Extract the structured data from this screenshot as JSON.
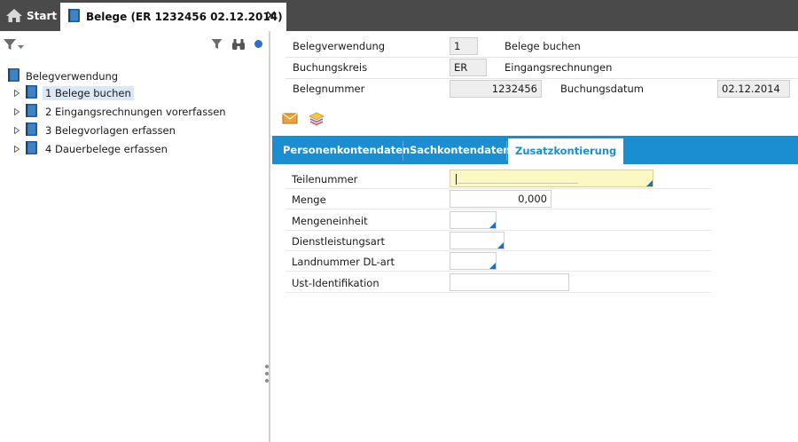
{
  "tabs": {
    "start_label": "Start",
    "active_label": "Belege (ER 1232456 02.12.2014)",
    "close_glyph": "✕"
  },
  "tree": {
    "root_label": "Belegverwendung",
    "items": [
      {
        "label": "1  Belege buchen",
        "selected": true
      },
      {
        "label": "2  Eingangsrechnungen vorerfassen",
        "selected": false
      },
      {
        "label": "3  Belegvorlagen erfassen",
        "selected": false
      },
      {
        "label": "4  Dauerbelege erfassen",
        "selected": false
      }
    ]
  },
  "header": {
    "belegverwendung_label": "Belegverwendung",
    "belegverwendung_value": "1",
    "belegverwendung_text": "Belege buchen",
    "buchungskreis_label": "Buchungskreis",
    "buchungskreis_value": "ER",
    "buchungskreis_text": "Eingangsrechnungen",
    "belegnummer_label": "Belegnummer",
    "belegnummer_value": "1232456",
    "buchungsdatum_label": "Buchungsdatum",
    "buchungsdatum_value": "02.12.2014"
  },
  "panel_tabs": [
    {
      "label": "Personenkontendaten"
    },
    {
      "label": "Sachkontendaten"
    },
    {
      "label": "Zusatzkontierung"
    }
  ],
  "form": {
    "teilenummer_label": "Teilenummer",
    "teilenummer_mask": "________________________",
    "menge_label": "Menge",
    "menge_value": "0,000",
    "mengeneinheit_label": "Mengeneinheit",
    "dienstleistungsart_label": "Dienstleistungsart",
    "landnummer_label": "Landnummer DL-art",
    "ust_label": "Ust-Identifikation"
  },
  "colors": {
    "tabbar": "#4a4a4a",
    "accent": "#1b8ed1",
    "selected_row": "#dbe8f7",
    "focus_field": "#fbf8c4"
  }
}
